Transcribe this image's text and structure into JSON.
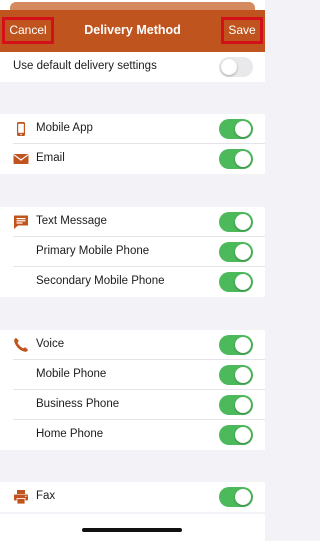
{
  "nav": {
    "title": "Delivery Method",
    "cancel_label": "Cancel",
    "save_label": "Save"
  },
  "default_settings": {
    "label": "Use default delivery settings",
    "enabled": false
  },
  "groups": {
    "app": [
      {
        "label": "Mobile App",
        "icon": "phone-icon",
        "enabled": true
      },
      {
        "label": "Email",
        "icon": "envelope-icon",
        "enabled": true
      }
    ],
    "text": [
      {
        "label": "Text Message",
        "icon": "message-icon",
        "enabled": true
      },
      {
        "label": "Primary Mobile Phone",
        "enabled": true
      },
      {
        "label": "Secondary Mobile Phone",
        "enabled": true
      }
    ],
    "voice": [
      {
        "label": "Voice",
        "icon": "handset-icon",
        "enabled": true
      },
      {
        "label": "Mobile Phone",
        "enabled": true
      },
      {
        "label": "Business Phone",
        "enabled": true
      },
      {
        "label": "Home Phone",
        "enabled": true
      }
    ],
    "fax": [
      {
        "label": "Fax",
        "icon": "printer-icon",
        "enabled": true
      }
    ]
  },
  "colors": {
    "nav_bg": "#c0541f",
    "highlight_border": "#d3101a",
    "toggle_on": "#4cba5b",
    "icon": "#c0541f"
  }
}
